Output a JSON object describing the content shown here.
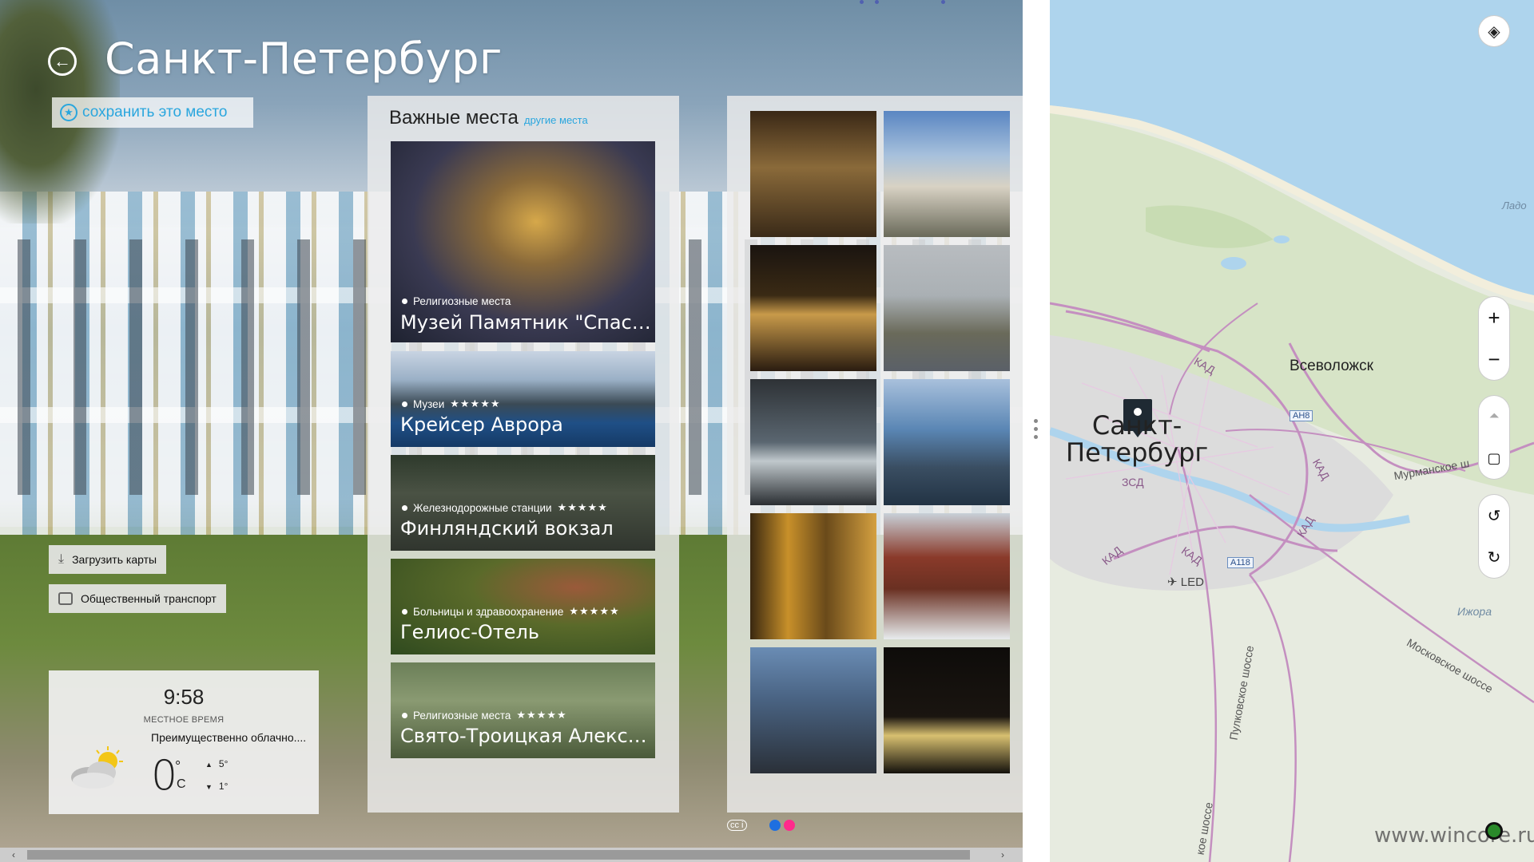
{
  "app": {
    "title": "Санкт-Петербург",
    "save_place_label": "сохранить это место",
    "buttons": {
      "download_maps": "Загрузить карты",
      "public_transport": "Общественный транспорт"
    },
    "weather": {
      "time": "9:58",
      "local_time_label": "МЕСТНОЕ ВРЕМЯ",
      "condition": "Преимущественно облачно....",
      "temp": "0",
      "deg_symbol": "°",
      "unit": "C",
      "high": "5°",
      "low": "1°"
    },
    "places": {
      "heading": "Важные места",
      "other_link": "другие места",
      "items": [
        {
          "category": "Религиозные места",
          "stars": "",
          "name": "Музей Памятник \"Спас-на-Крови\"",
          "bg": "#6a5a3a"
        },
        {
          "category": "Музеи",
          "stars": "★★★★★",
          "name": "Крейсер Аврора",
          "bg": "#2f4f78"
        },
        {
          "category": "Железнодорожные станции",
          "stars": "★★★★★",
          "name": "Финляндский вокзал",
          "bg": "#3a3f36"
        },
        {
          "category": "Больницы и здравоохранение",
          "stars": "★★★★★",
          "name": "Гелиос-Отель",
          "bg": "#3f5a2a"
        },
        {
          "category": "Религиозные места",
          "stars": "★★★★★",
          "name": "Свято-Троицкая Александро-Невская лавра",
          "bg": "#5d6a4b"
        }
      ]
    },
    "photos": [
      {
        "name": "photo-palace-hall",
        "bg": "#4a3524"
      },
      {
        "name": "photo-colonnade-stairs",
        "bg": "#8aa5c7"
      },
      {
        "name": "photo-night-square",
        "bg": "#3a2e1e"
      },
      {
        "name": "photo-admiralty",
        "bg": "#7f8a91"
      },
      {
        "name": "photo-winter-palace-night",
        "bg": "#3f474f"
      },
      {
        "name": "photo-canal-church",
        "bg": "#6c88ad"
      },
      {
        "name": "photo-golden-hall",
        "bg": "#6b4d1c"
      },
      {
        "name": "photo-red-gate",
        "bg": "#8c4a3c"
      },
      {
        "name": "photo-cathedral-statues",
        "bg": "#4f6b88"
      },
      {
        "name": "photo-palace-night-lights",
        "bg": "#1d1a14"
      }
    ],
    "pager_dot_colors": [
      "#1e6fe0",
      "#ff2a8c"
    ],
    "photo_credit": "cc i"
  },
  "map": {
    "city_label": "Санкт-\nПетербург",
    "labels": {
      "vsevolozhsk": "Всеволожск",
      "ladozh": "Ладо",
      "murmanskoe": "Мурманское ш",
      "izhora": "Ижора",
      "moskovskoe": "Московское шоссе",
      "pulkovskoe": "Пулковское шоссе",
      "led": "LED",
      "kad": "КАД",
      "zsd": "ЗСД",
      "ah8": "АН8",
      "a118": "A118",
      "shosse": "кое шоссе"
    },
    "controls": {
      "zoom_in": "+",
      "zoom_out": "−"
    },
    "watermark": "www.wincore.ru"
  }
}
